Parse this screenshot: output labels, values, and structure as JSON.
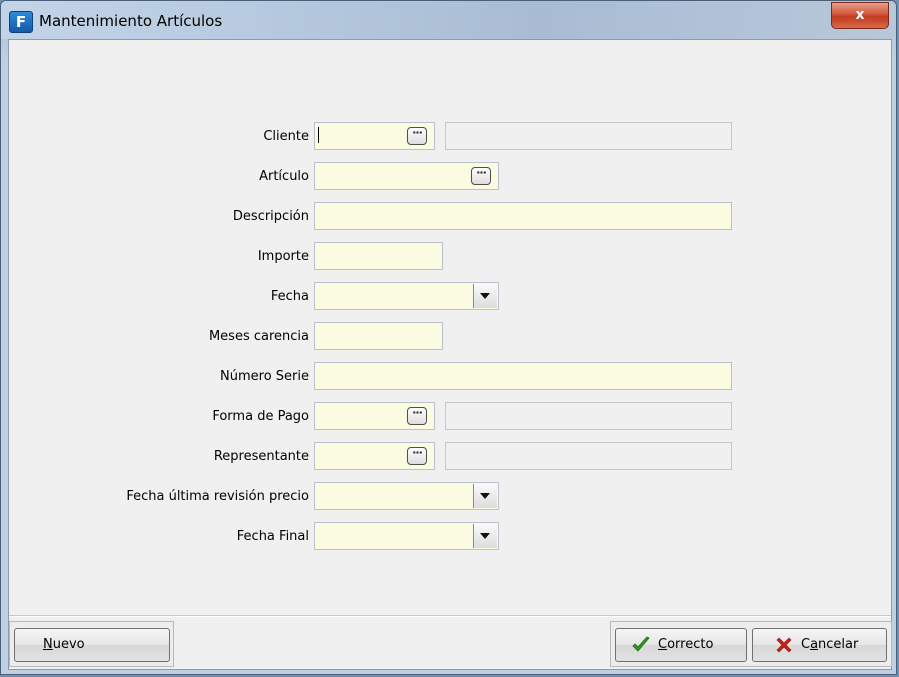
{
  "window": {
    "title": "Mantenimiento Artículos",
    "close_label": "x"
  },
  "form": {
    "cliente_label": "Cliente",
    "articulo_label": "Artículo",
    "descripcion_label": "Descripción",
    "importe_label": "Importe",
    "fecha_label": "Fecha",
    "meses_carencia_label": "Meses carencia",
    "numero_serie_label": "Número Serie",
    "forma_pago_label": "Forma de Pago",
    "representante_label": "Representante",
    "fecha_ultima_revision_label": "Fecha última revisión precio",
    "fecha_final_label": "Fecha Final",
    "cliente_value": "",
    "cliente_name_value": "",
    "articulo_value": "",
    "descripcion_value": "",
    "importe_value": "",
    "fecha_value": "",
    "meses_carencia_value": "",
    "numero_serie_value": "",
    "forma_pago_value": "",
    "forma_pago_name_value": "",
    "representante_value": "",
    "representante_name_value": "",
    "fecha_ultima_revision_value": "",
    "fecha_final_value": "",
    "ellipsis_glyph": "···"
  },
  "buttons": {
    "nuevo_label_underlined": "N",
    "nuevo_label_rest": "uevo",
    "correcto_label_underlined": "C",
    "correcto_label_rest": "orrecto",
    "cancelar_label_pre": "C",
    "cancelar_label_underlined": "a",
    "cancelar_label_rest": "ncelar"
  },
  "icons": {
    "app": "app-logo-icon",
    "ok": "green-checkmark-icon",
    "cancel": "red-x-icon"
  },
  "colors": {
    "field_bg": "#fbfbe1",
    "close_button": "#c43a1f",
    "check_green": "#2e9a1e",
    "cancel_red": "#c8201a"
  }
}
